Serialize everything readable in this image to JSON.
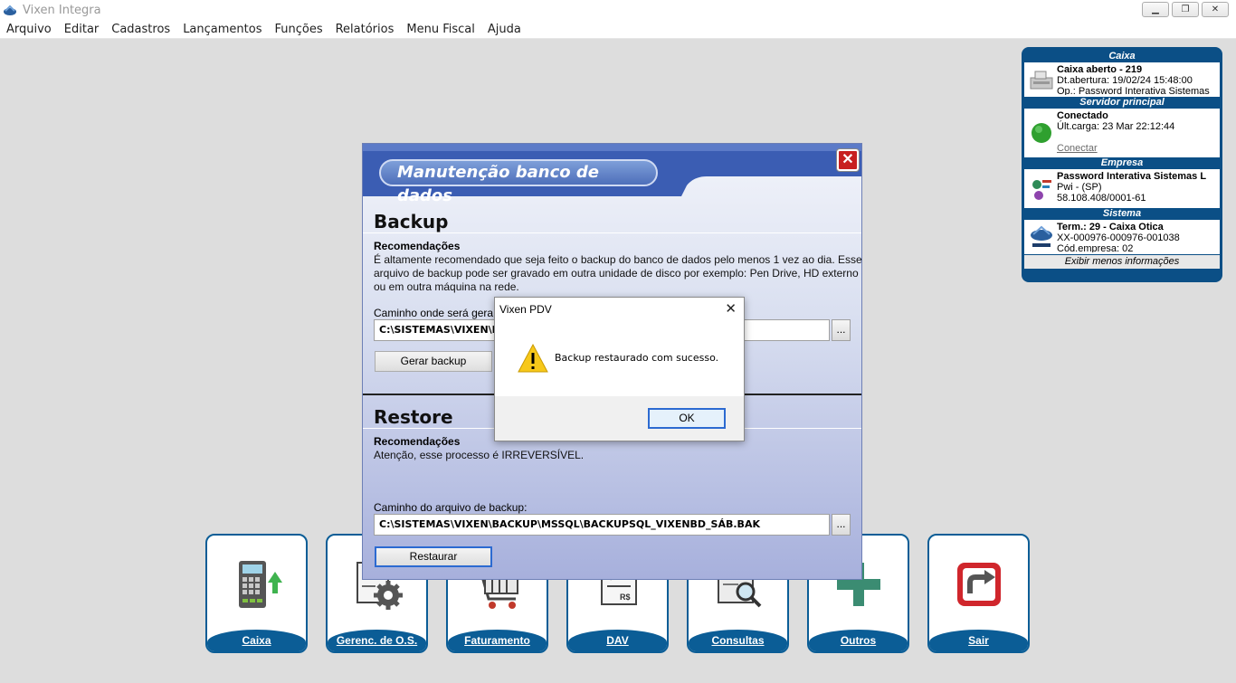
{
  "window": {
    "title": "Vixen Integra"
  },
  "menu": [
    "Arquivo",
    "Editar",
    "Cadastros",
    "Lançamentos",
    "Funções",
    "Relatórios",
    "Menu Fiscal",
    "Ajuda"
  ],
  "info_panel": {
    "caixa": {
      "header": "Caixa",
      "line1": "Caixa aberto - 219",
      "line2": "Dt.abertura: 19/02/24 15:48:00",
      "line3": "Op.: Password Interativa Sistemas"
    },
    "servidor": {
      "header": "Servidor principal",
      "line1": "Conectado",
      "line2": "Últ.carga: 23 Mar 22:12:44",
      "link": "Conectar"
    },
    "empresa": {
      "header": "Empresa",
      "line1": "Password Interativa Sistemas L",
      "line2": "Pwi - (SP)",
      "line3": "58.108.408/0001-61"
    },
    "sistema": {
      "header": "Sistema",
      "line1": "Term.: 29 - Caixa Otica",
      "line2": "XX-000976-000976-001038",
      "line3": "Cód.empresa: 02"
    },
    "footer": "Exibir menos informações"
  },
  "tiles": [
    {
      "label": "Caixa",
      "icon": "cash-register-icon"
    },
    {
      "label": "Gerenc. de O.S.",
      "icon": "os-gear-icon"
    },
    {
      "label": "Faturamento",
      "icon": "cart-icon"
    },
    {
      "label": "DAV",
      "icon": "dav-document-icon"
    },
    {
      "label": "Consultas",
      "icon": "search-document-icon"
    },
    {
      "label": "Outros",
      "icon": "plus-icon"
    },
    {
      "label": "Sair",
      "icon": "exit-icon"
    }
  ],
  "dialog": {
    "title": "Manutenção banco de dados",
    "backup": {
      "title": "Backup",
      "rec_title": "Recomendações",
      "rec_text": "É altamente recomendado que seja feito o backup do banco de dados pelo menos 1 vez ao dia. Esse arquivo de backup pode ser gravado em outra unidade de disco por exemplo: Pen Drive, HD externo ou em outra máquina na rede.",
      "path_label": "Caminho onde será gera",
      "path_value": "C:\\SISTEMAS\\VIXEN\\BA",
      "button": "Gerar backup"
    },
    "restore": {
      "title": "Restore",
      "rec_title": "Recomendações",
      "rec_text": "Atenção, esse processo é IRREVERSÍVEL.",
      "path_label": "Caminho do arquivo de backup:",
      "path_value": "C:\\SISTEMAS\\VIXEN\\BACKUP\\MSSQL\\BACKUPSQL_VIXENBD_SÁB.BAK",
      "button": "Restaurar"
    },
    "browse": "..."
  },
  "msgbox": {
    "title": "Vixen PDV",
    "message": "Backup restaurado com sucesso.",
    "ok": "OK"
  }
}
